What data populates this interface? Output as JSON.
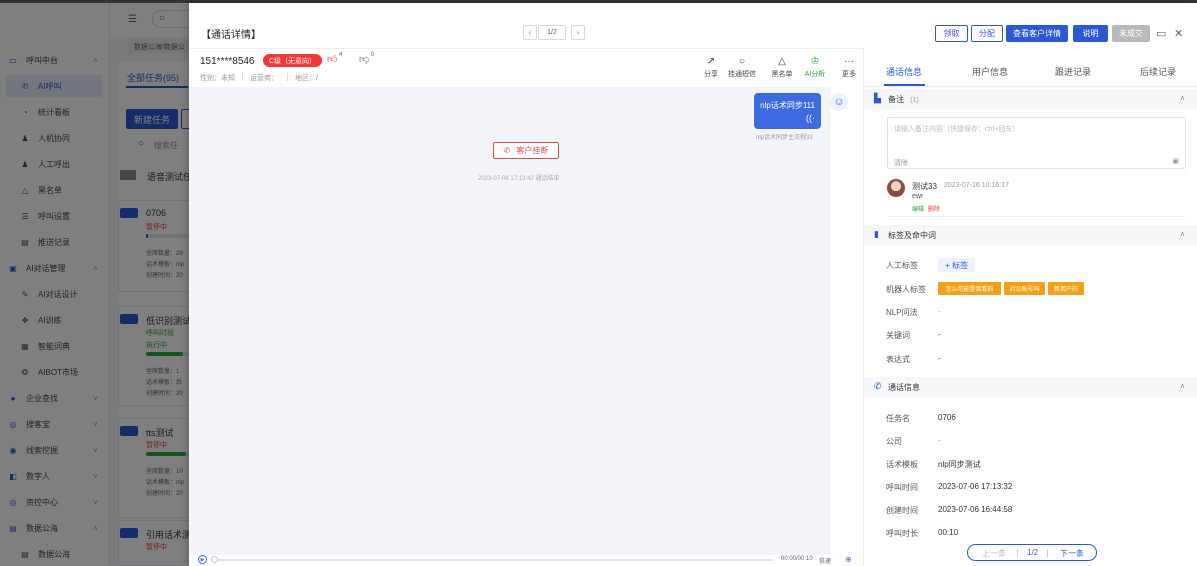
{
  "background": {
    "sidebar": [
      {
        "label": "呼叫中台",
        "icon": "monitor-icon",
        "group": true,
        "chev": "∧"
      },
      {
        "label": "AI呼叫",
        "icon": "phone-icon",
        "active": true
      },
      {
        "label": "统计看板",
        "icon": "pie-icon"
      },
      {
        "label": "人机协同",
        "icon": "user-icon"
      },
      {
        "label": "人工呼出",
        "icon": "user-icon"
      },
      {
        "label": "黑名单",
        "icon": "warning-icon"
      },
      {
        "label": "呼叫设置",
        "icon": "settings-icon"
      },
      {
        "label": "推送记录",
        "icon": "list-icon"
      },
      {
        "label": "AI对话管理",
        "icon": "chat-icon",
        "group": true,
        "chev": "∧"
      },
      {
        "label": "AI对话设计",
        "icon": "pen-icon"
      },
      {
        "label": "AI训练",
        "icon": "train-icon"
      },
      {
        "label": "智能词典",
        "icon": "book-icon"
      },
      {
        "label": "AIBOT市场",
        "icon": "market-icon"
      },
      {
        "label": "企业查找",
        "icon": "location-icon",
        "group": true,
        "chev": "∨"
      },
      {
        "label": "搜客宝",
        "icon": "search-icon",
        "group": true,
        "chev": "∨"
      },
      {
        "label": "线索挖掘",
        "icon": "target-icon",
        "group": true,
        "chev": "∨"
      },
      {
        "label": "数字人",
        "icon": "person-icon",
        "group": true,
        "chev": "∨"
      },
      {
        "label": "资控中心",
        "icon": "search-icon",
        "group": true,
        "chev": "∨"
      },
      {
        "label": "数据公海",
        "icon": "db-icon",
        "group": true,
        "chev": "∧"
      },
      {
        "label": "数据公海",
        "icon": "db-icon"
      }
    ],
    "breadcrumb": "数据公海/数据公",
    "tab_all": "全部任务(95)",
    "new_task": "新建任务",
    "search_ph": "搜索任",
    "group_title": "语音测试任",
    "cards": [
      {
        "title": "0706",
        "status": "暂停中",
        "status_type": "red",
        "progress": 0.02,
        "lines": [
          "坐席数量：29",
          "话术模板：nlp",
          "创建时间：20"
        ]
      },
      {
        "title": "低识别测试",
        "status": "呼叫时段",
        "status2": "执行中",
        "status_type": "green",
        "progress": 0.85,
        "lines": [
          "坐席数量：1",
          "话术模板：后",
          "创建时间：20"
        ]
      },
      {
        "title": "tts测试",
        "status": "暂停中",
        "status_type": "red",
        "progress": 0.9,
        "lines": [
          "坐席数量：10",
          "话术模板：nlp",
          "创建时间：20"
        ]
      },
      {
        "title": "引用话术测",
        "status": "暂停中",
        "status_type": "red",
        "progress": 0,
        "lines": []
      }
    ]
  },
  "drawer": {
    "title": "【通话详情】",
    "pager": {
      "prev": "‹",
      "text": "1/2",
      "next": "›"
    },
    "buttons": {
      "claim": "领取",
      "assign": "分配",
      "customer_detail": "查看客户详情",
      "explain": "说明",
      "deal": "未成交"
    },
    "header": {
      "phone": "151****8546",
      "grade": "C级（无意向）",
      "thumbs_up_count": "4",
      "thumbs_down_count": "0",
      "gender": "性别：未知",
      "operator": "运营商：",
      "region": "地区：/"
    },
    "tools": [
      {
        "icon": "↗",
        "label": "分享",
        "name": "share",
        "green": false
      },
      {
        "icon": "○",
        "label": "挂通短信",
        "name": "sms",
        "green": false
      },
      {
        "icon": "△",
        "label": "黑名单",
        "name": "blacklist",
        "green": false
      },
      {
        "icon": "♔",
        "label": "AI分析",
        "name": "ai-analysis",
        "green": true
      },
      {
        "icon": "···",
        "label": "更多",
        "name": "more",
        "green": false
      }
    ],
    "conversation": {
      "bubble_text": "nlp话术同步111",
      "bubble_audio": "((·",
      "bubble_sub": "nlp话术同步主流程33",
      "hangup": "客户挂断",
      "hangup_time": "2023-07-06 17:13:42 通话结束"
    },
    "player": {
      "play": "▶",
      "time": "00:00/00:10",
      "speed": "倍速",
      "download": "⊕",
      "progress": 0
    }
  },
  "right_panel": {
    "tabs": [
      "通话信息",
      "用户信息",
      "跟进记录",
      "后续记录"
    ],
    "active_tab": 0,
    "notes": {
      "title": "备注",
      "count": "(1)",
      "placeholder": "请输入备注内容（快捷保存：ctrl+回车）",
      "clear": "清除",
      "comment_user": "测试33",
      "comment_time": "2023-07-16 10:16:17",
      "comment_text": "ewr",
      "edit": "编辑",
      "delete": "删除"
    },
    "tags": {
      "title": "标签及命中词",
      "manual_label": "人工标签",
      "add_tag": "+ 标签",
      "robot_label": "机器人标签",
      "robot_tags": [
        "怎么可能是我看的",
        "对公账号吗",
        "新用户的"
      ],
      "nlp_label": "NLP问法",
      "nlp_value": "-",
      "keyword_label": "关键词",
      "keyword_value": "-",
      "expression_label": "表达式",
      "expression_value": "-"
    },
    "call_info": {
      "title": "通话信息",
      "rows": [
        {
          "label": "任务名",
          "value": "0706"
        },
        {
          "label": "公司",
          "value": "-"
        },
        {
          "label": "话术模板",
          "value": "nlp同步测试"
        },
        {
          "label": "呼叫时间",
          "value": "2023-07-06 17:13:32"
        },
        {
          "label": "创建时间",
          "value": "2023-07-06 16:44:58"
        },
        {
          "label": "呼叫时长",
          "value": "00:10"
        }
      ]
    },
    "bottom_pager": {
      "prev": "上一条",
      "text": "1/2",
      "next": "下一条"
    }
  },
  "colors": {
    "primary": "#2d58d3",
    "danger": "#f03a3a",
    "tag_orange": "#f4a118",
    "success": "#27a644"
  }
}
